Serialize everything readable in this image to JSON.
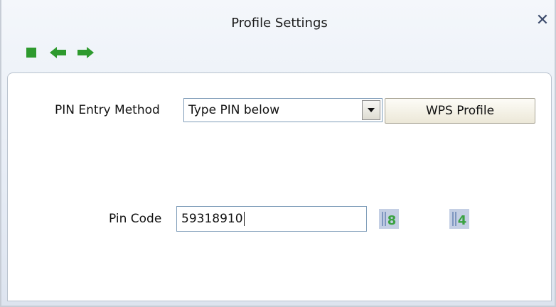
{
  "window": {
    "title": "Profile Settings",
    "close_label": "✕"
  },
  "toolbar": {
    "icons": [
      "stop-icon",
      "back-arrow-icon",
      "forward-arrow-icon"
    ]
  },
  "form": {
    "pin_entry_method_label": "PIN Entry Method",
    "pin_entry_method_value": "Type PIN below",
    "wps_profile_button": "WPS Profile",
    "pin_code_label": "Pin Code",
    "pin_code_value": "59318910",
    "digit_button_1": "8",
    "digit_button_2": "4"
  },
  "colors": {
    "toolbar_green": "#2e9a2e",
    "icon_button_bg": "#c4cfe4",
    "icon_glyph_green": "#3aa241"
  }
}
